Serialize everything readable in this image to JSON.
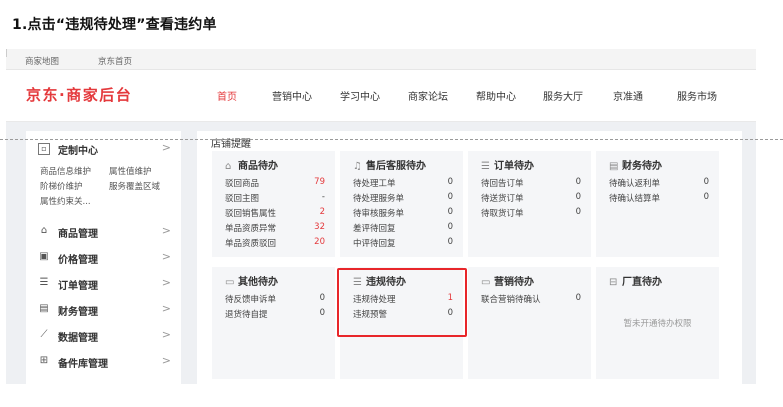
{
  "instruction": "1.点击“违规待处理”查看违约单",
  "topbar": {
    "merchant_map": "商家地图",
    "jd_home": "京东首页"
  },
  "header": {
    "logo": "京东·商家后台",
    "nav": [
      "首页",
      "营销中心",
      "学习中心",
      "商家论坛",
      "帮助中心",
      "服务大厅",
      "京准通",
      "服务市场"
    ],
    "active_nav": "首页"
  },
  "sidebar": {
    "custom_center": {
      "label": "定制中心",
      "icon": "customize-icon",
      "subs": [
        "商品信息维护",
        "属性值维护",
        "阶梯价维护",
        "服务覆盖区域",
        "属性约束关..."
      ]
    },
    "items": [
      {
        "label": "商品管理",
        "icon": "bag-icon"
      },
      {
        "label": "价格管理",
        "icon": "price-icon"
      },
      {
        "label": "订单管理",
        "icon": "order-icon"
      },
      {
        "label": "财务管理",
        "icon": "finance-icon"
      },
      {
        "label": "数据管理",
        "icon": "chart-icon"
      },
      {
        "label": "备件库管理",
        "icon": "warehouse-icon"
      }
    ]
  },
  "main": {
    "title": "店铺提醒",
    "cards": [
      {
        "title": "商品待办",
        "icon": "bag-icon",
        "rows": [
          {
            "label": "驳回商品",
            "value": "79",
            "red": true
          },
          {
            "label": "驳回主图",
            "value": "-",
            "red": false
          },
          {
            "label": "驳回销售属性",
            "value": "2",
            "red": true
          },
          {
            "label": "单品资质异常",
            "value": "32",
            "red": true
          },
          {
            "label": "单品资质驳回",
            "value": "20",
            "red": true
          }
        ]
      },
      {
        "title": "售后客服待办",
        "icon": "headset-icon",
        "rows": [
          {
            "label": "待处理工单",
            "value": "0"
          },
          {
            "label": "待处理服务单",
            "value": "0"
          },
          {
            "label": "待审核服务单",
            "value": "0"
          },
          {
            "label": "差评待回复",
            "value": "0"
          },
          {
            "label": "中评待回复",
            "value": "0"
          }
        ]
      },
      {
        "title": "订单待办",
        "icon": "order-icon",
        "rows": [
          {
            "label": "待回告订单",
            "value": "0"
          },
          {
            "label": "待送货订单",
            "value": "0"
          },
          {
            "label": "待取货订单",
            "value": "0"
          }
        ]
      },
      {
        "title": "财务待办",
        "icon": "finance-icon",
        "rows": [
          {
            "label": "待确认返利单",
            "value": "0"
          },
          {
            "label": "待确认结算单",
            "value": "0"
          }
        ]
      },
      {
        "title": "其他待办",
        "icon": "folder-icon",
        "rows": [
          {
            "label": "待反馈申诉单",
            "value": "0"
          },
          {
            "label": "退货待自提",
            "value": "0"
          }
        ]
      },
      {
        "title": "违规待办",
        "icon": "violation-icon",
        "rows": [
          {
            "label": "违规待处理",
            "value": "1",
            "red": true
          },
          {
            "label": "违规预警",
            "value": "0"
          }
        ]
      },
      {
        "title": "营销待办",
        "icon": "marketing-icon",
        "rows": [
          {
            "label": "联合营销待确认",
            "value": "0"
          }
        ]
      },
      {
        "title": "厂直待办",
        "icon": "factory-icon",
        "no_permission": "暂未开通待办权限"
      }
    ]
  }
}
